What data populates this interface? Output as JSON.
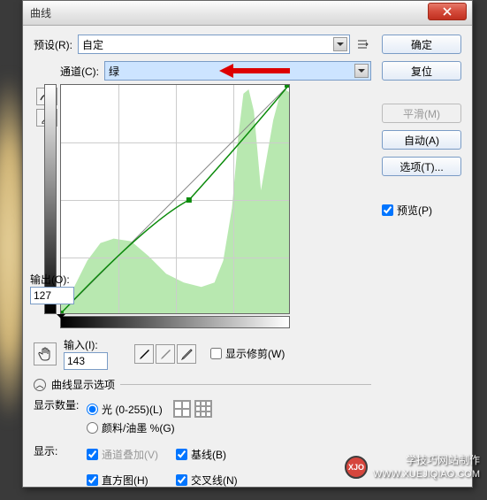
{
  "title": "曲线",
  "preset": {
    "label": "预设(R):",
    "value": "自定"
  },
  "channel": {
    "label": "通道(C):",
    "value": "绿"
  },
  "output": {
    "label": "输出(O):",
    "value": "127"
  },
  "input": {
    "label": "输入(I):",
    "value": "143"
  },
  "show_clipping": "显示修剪(W)",
  "curve_options": "曲线显示选项",
  "display_amount": {
    "label": "显示数量:",
    "light": "光 (0-255)(L)",
    "pigment": "颜料/油墨 %(G)"
  },
  "show": {
    "label": "显示:",
    "channel_overlay": "通道叠加(V)",
    "baseline": "基线(B)",
    "histogram": "直方图(H)",
    "intersection": "交叉线(N)"
  },
  "buttons": {
    "ok": "确定",
    "reset": "复位",
    "smooth": "平滑(M)",
    "auto": "自动(A)",
    "options": "选项(T)...",
    "preview": "预览(P)"
  },
  "watermark": {
    "site": "学技巧网站制作",
    "url": "WWW.XUEJIQIAO.COM",
    "logo": "XJO"
  },
  "chart_data": {
    "type": "line",
    "title": "Curves (Green Channel)",
    "xlabel": "Input",
    "ylabel": "Output",
    "xlim": [
      0,
      255
    ],
    "ylim": [
      0,
      255
    ],
    "series": [
      {
        "name": "curve",
        "x": [
          0,
          143,
          255
        ],
        "y": [
          0,
          127,
          255
        ]
      },
      {
        "name": "baseline",
        "x": [
          0,
          255
        ],
        "y": [
          0,
          255
        ]
      }
    ],
    "selected_point": {
      "input": 143,
      "output": 127
    },
    "histogram_channel": "green"
  }
}
